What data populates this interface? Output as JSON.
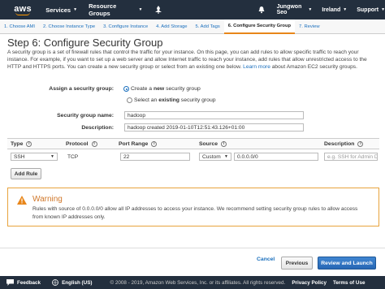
{
  "topbar": {
    "logo": "aws",
    "services": "Services",
    "resource_groups": "Resource Groups",
    "user": "Jungwon Seo",
    "region": "Ireland",
    "support": "Support"
  },
  "steps": [
    "1. Choose AMI",
    "2. Choose Instance Type",
    "3. Configure Instance",
    "4. Add Storage",
    "5. Add Tags",
    "6. Configure Security Group",
    "7. Review"
  ],
  "active_step": 5,
  "page": {
    "title": "Step 6: Configure Security Group",
    "description": "A security group is a set of firewall rules that control the traffic for your instance. On this page, you can add rules to allow specific traffic to reach your instance. For example, if you want to set up a web server and allow Internet traffic to reach your instance, add rules that allow unrestricted access to the HTTP and HTTPS ports. You can create a new security group or select from an existing one below.",
    "learn_more": "Learn more",
    "description_tail": "about Amazon EC2 security groups."
  },
  "assign": {
    "label": "Assign a security group:",
    "option_new_prefix": "Create a ",
    "option_new_bold": "new",
    "option_new_suffix": " security group",
    "option_existing_prefix": "Select an ",
    "option_existing_bold": "existing",
    "option_existing_suffix": " security group",
    "selected": "new"
  },
  "sg_name": {
    "label": "Security group name:",
    "value": "hadoop"
  },
  "sg_desc": {
    "label": "Description:",
    "value": "hadoop created 2019-01-10T12:51:43.126+01:00"
  },
  "rules_table": {
    "columns": [
      "Type",
      "Protocol",
      "Port Range",
      "Source",
      "Description"
    ],
    "rows": [
      {
        "type": "SSH",
        "protocol": "TCP",
        "port": "22",
        "source_mode": "Custom",
        "source_cidr": "0.0.0.0/0",
        "description_placeholder": "e.g. SSH for Admin D"
      }
    ],
    "add_rule": "Add Rule"
  },
  "warning": {
    "title": "Warning",
    "body": "Rules with source of 0.0.0.0/0 allow all IP addresses to access your instance. We recommend setting security group rules to allow access from known IP addresses only."
  },
  "actions": {
    "cancel": "Cancel",
    "previous": "Previous",
    "review": "Review and Launch"
  },
  "footer": {
    "feedback": "Feedback",
    "language": "English (US)",
    "copyright": "© 2008 - 2019, Amazon Web Services, Inc. or its affiliates. All rights reserved.",
    "privacy": "Privacy Policy",
    "terms": "Terms of Use"
  },
  "colors": {
    "nav_bg": "#232f3e",
    "accent_orange": "#ff9900",
    "link_blue": "#1a6fbd",
    "primary_blue": "#2867b5",
    "warning_border": "#e8a33d"
  }
}
